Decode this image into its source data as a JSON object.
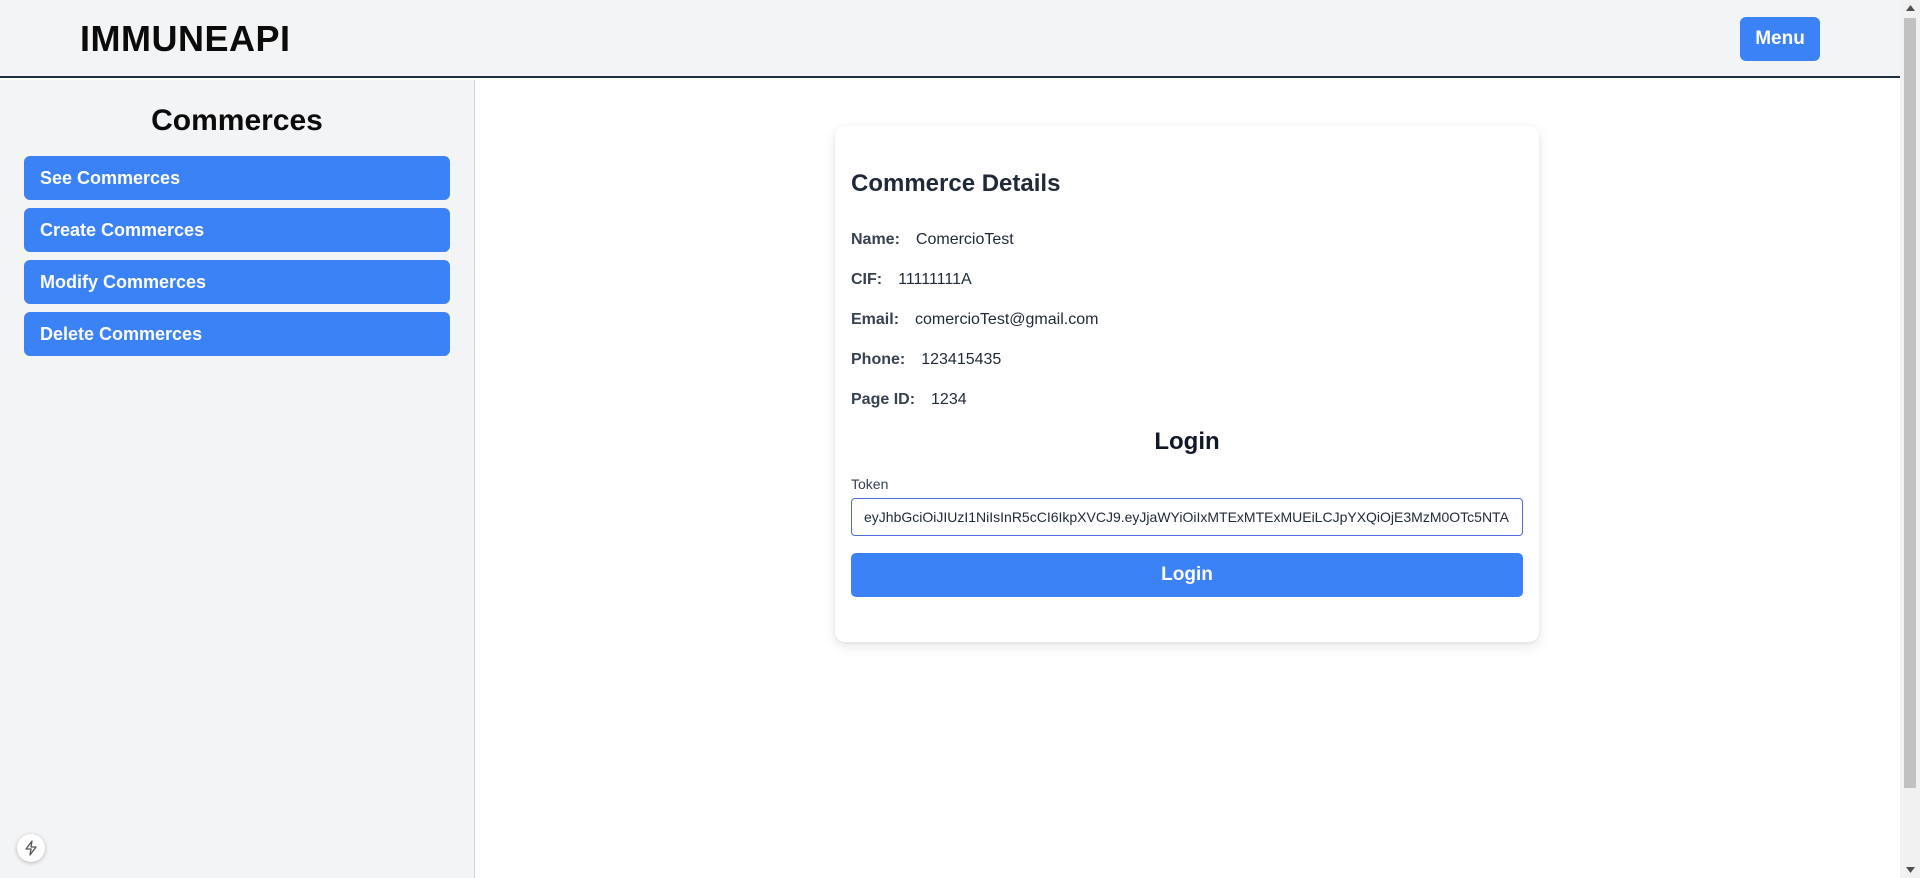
{
  "header": {
    "brand": "IMMUNEAPI",
    "menu_label": "Menu"
  },
  "sidebar": {
    "title": "Commerces",
    "items": [
      {
        "label": "See Commerces"
      },
      {
        "label": "Create Commerces"
      },
      {
        "label": "Modify Commerces"
      },
      {
        "label": "Delete Commerces"
      }
    ]
  },
  "details": {
    "title": "Commerce Details",
    "fields": [
      {
        "label": "Name:",
        "value": "ComercioTest"
      },
      {
        "label": "CIF:",
        "value": "11111111A"
      },
      {
        "label": "Email:",
        "value": "comercioTest@gmail.com"
      },
      {
        "label": "Phone:",
        "value": "123415435"
      },
      {
        "label": "Page ID:",
        "value": "1234"
      }
    ]
  },
  "login": {
    "heading": "Login",
    "token_label": "Token",
    "token_value": "eyJhbGciOiJIUzI1NiIsInR5cCI6IkpXVCJ9.eyJjaWYiOiIxMTExMTExMUEiLCJpYXQiOjE3MzM0OTc5NTA",
    "button_label": "Login"
  },
  "colors": {
    "accent": "#3b82f6",
    "header_bg": "#f3f4f6",
    "header_border": "#1f2f3f"
  },
  "icons": {
    "bolt_badge": "bolt-icon",
    "scroll_up": "scroll-up-arrow-icon",
    "scroll_down": "scroll-down-arrow-icon"
  }
}
